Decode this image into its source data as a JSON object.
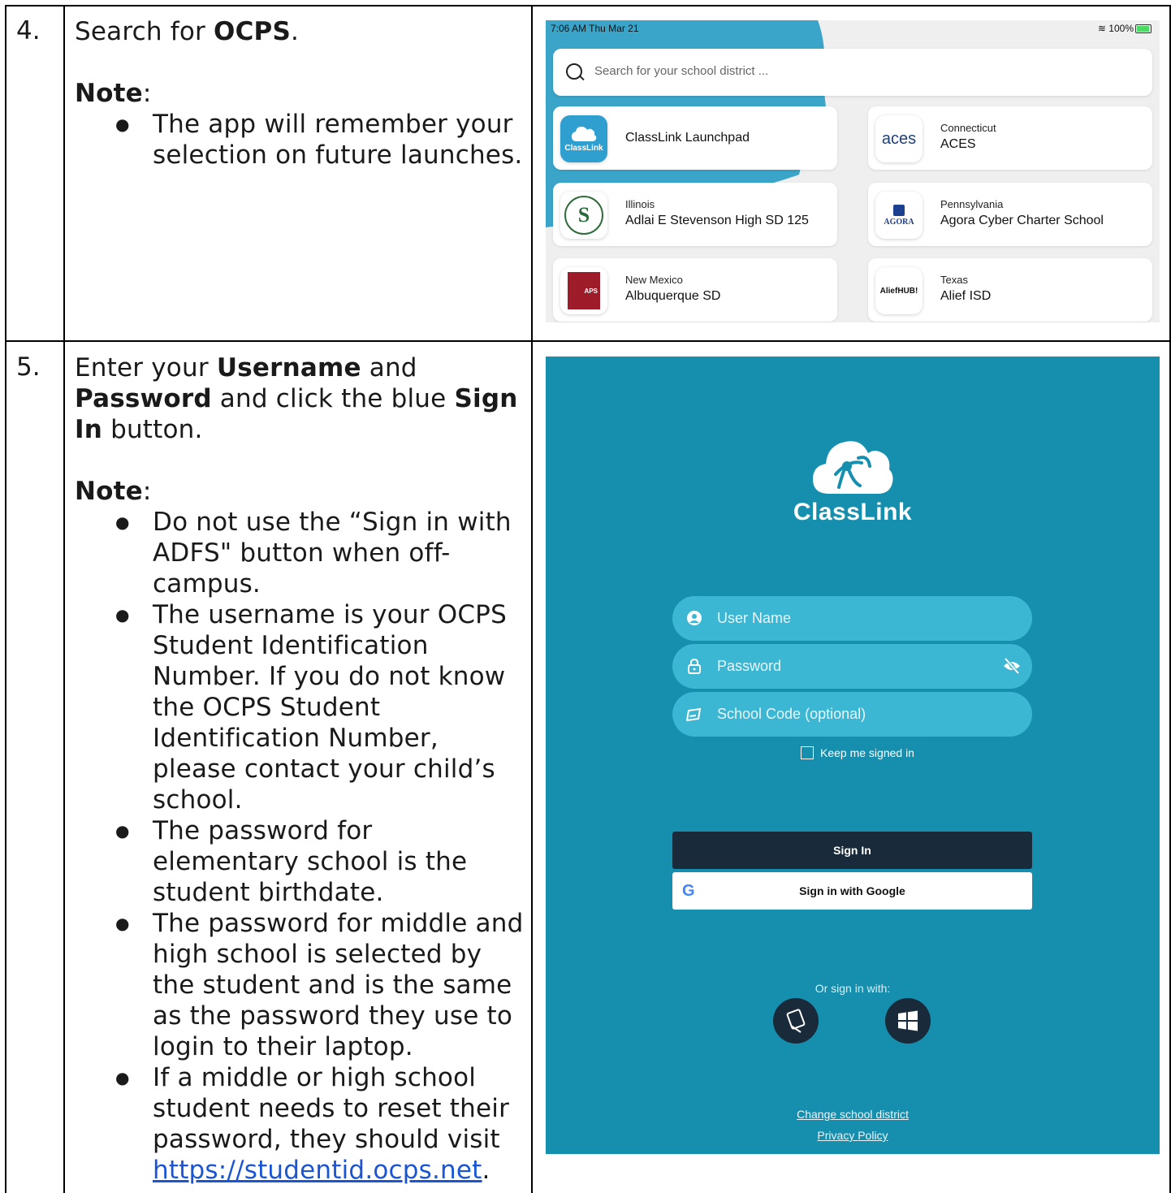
{
  "step4": {
    "number": "4.",
    "intro_prefix": "Search for ",
    "intro_bold": "OCPS",
    "intro_suffix": ".",
    "note_label": "Note",
    "note_colon": ":",
    "bullets": [
      "The app will remember your selection on future launches."
    ]
  },
  "step5": {
    "number": "5.",
    "t1": "Enter your ",
    "b1": "Username",
    "t2": " and ",
    "b2": "Password",
    "t3": " and click the blue ",
    "b3": "Sign In",
    "t4": " button.",
    "note_label": "Note",
    "note_colon": ":",
    "bullets": [
      "Do not use the “Sign in with ADFS\" button when off-campus.",
      "The username is your OCPS Student Identification Number. If you do not know the OCPS Student Identification Number, please contact your child’s school.",
      "The password for elementary school is the student birthdate.",
      "The password for middle and high school is selected by the student and is the same as the password they use to login to their laptop."
    ],
    "last_bullet_text": "If a middle or high school student needs to reset their password, they should visit ",
    "last_bullet_link": "https://studentid.ocps.net",
    "last_bullet_end": "."
  },
  "district_screen": {
    "status_time": "7:06 AM   Thu Mar 21",
    "status_battery": "100%",
    "search_placeholder": "Search for your school district ...",
    "cards": [
      {
        "state": "",
        "name": "ClassLink Launchpad",
        "logo": "ClassLink"
      },
      {
        "state": "Connecticut",
        "name": "ACES",
        "logo": "aces"
      },
      {
        "state": "Illinois",
        "name": "Adlai E Stevenson High SD 125",
        "logo": "S"
      },
      {
        "state": "Pennsylvania",
        "name": "Agora Cyber Charter School",
        "logo": "AGORA"
      },
      {
        "state": "New Mexico",
        "name": "Albuquerque SD",
        "logo": "APS"
      },
      {
        "state": "Texas",
        "name": "Alief ISD",
        "logo": "AliefHUB!"
      }
    ],
    "accent_color": "#3aa5c9"
  },
  "login_screen": {
    "brand": "ClassLink",
    "username_placeholder": "User Name",
    "password_placeholder": "Password",
    "school_code_placeholder": "School Code (optional)",
    "keep_signed_in": "Keep me signed in",
    "sign_in": "Sign In",
    "sign_in_google": "Sign in with Google",
    "google_glyph": "G",
    "or_sign_in_with": "Or sign in with:",
    "change_district": "Change school district",
    "privacy_policy": "Privacy Policy",
    "background_color": "#168fae",
    "button_color": "#192a3a"
  }
}
